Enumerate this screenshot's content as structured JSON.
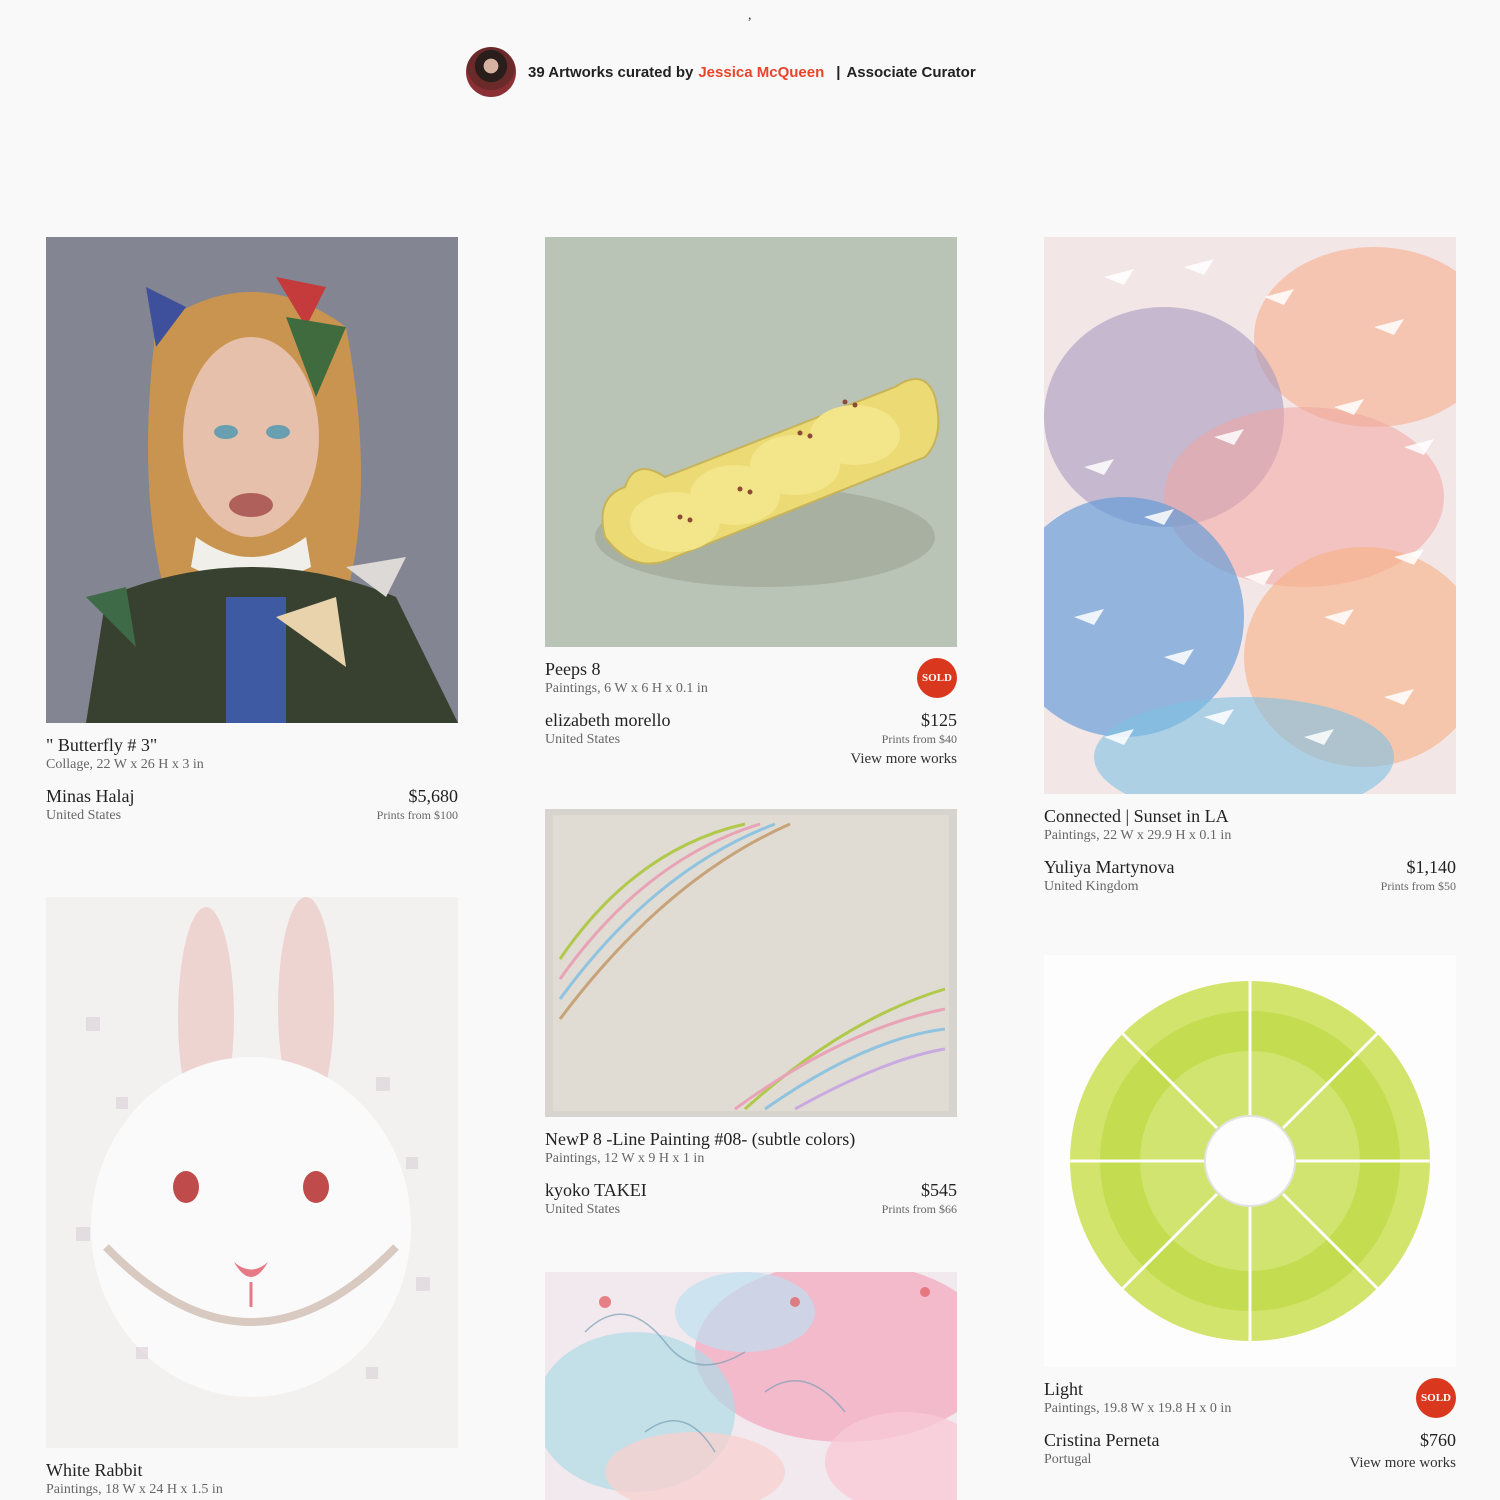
{
  "header": {
    "tick_mark": ",",
    "count_text": "39 Artworks curated by",
    "curator_name": "Jessica McQueen",
    "separator": "|",
    "curator_role": "Associate Curator"
  },
  "colors": {
    "accent": "#e8452c",
    "sold_badge": "#d9381e",
    "background": "#f9f9f9"
  },
  "artworks": [
    {
      "title": "\" Butterfly # 3\"",
      "details": "Collage, 22 W x 26 H x 3 in",
      "artist": "Minas Halaj",
      "country": "United States",
      "price": "$5,680",
      "prints": "Prints from $100"
    },
    {
      "title": "Peeps 8",
      "details": "Paintings, 6 W x 6 H x 0.1 in",
      "artist": "elizabeth morello",
      "country": "United States",
      "price": "$125",
      "prints": "Prints from $40",
      "more": "View more works",
      "sold": "SOLD"
    },
    {
      "title": "Connected | Sunset in LA",
      "details": "Paintings, 22 W x 29.9 H x 0.1 in",
      "artist": "Yuliya Martynova",
      "country": "United Kingdom",
      "price": "$1,140",
      "prints": "Prints from $50"
    },
    {
      "title": "White Rabbit",
      "details": "Paintings, 18 W x 24 H x 1.5 in"
    },
    {
      "title": "NewP 8 -Line Painting #08- (subtle colors)",
      "details": "Paintings, 12 W x 9 H x 1 in",
      "artist": "kyoko TAKEI",
      "country": "United States",
      "price": "$545",
      "prints": "Prints from $66"
    },
    {
      "title": "Light",
      "details": "Paintings, 19.8 W x 19.8 H x 0 in",
      "artist": "Cristina Perneta",
      "country": "Portugal",
      "price": "$760",
      "more": "View more works",
      "sold": "SOLD"
    }
  ]
}
